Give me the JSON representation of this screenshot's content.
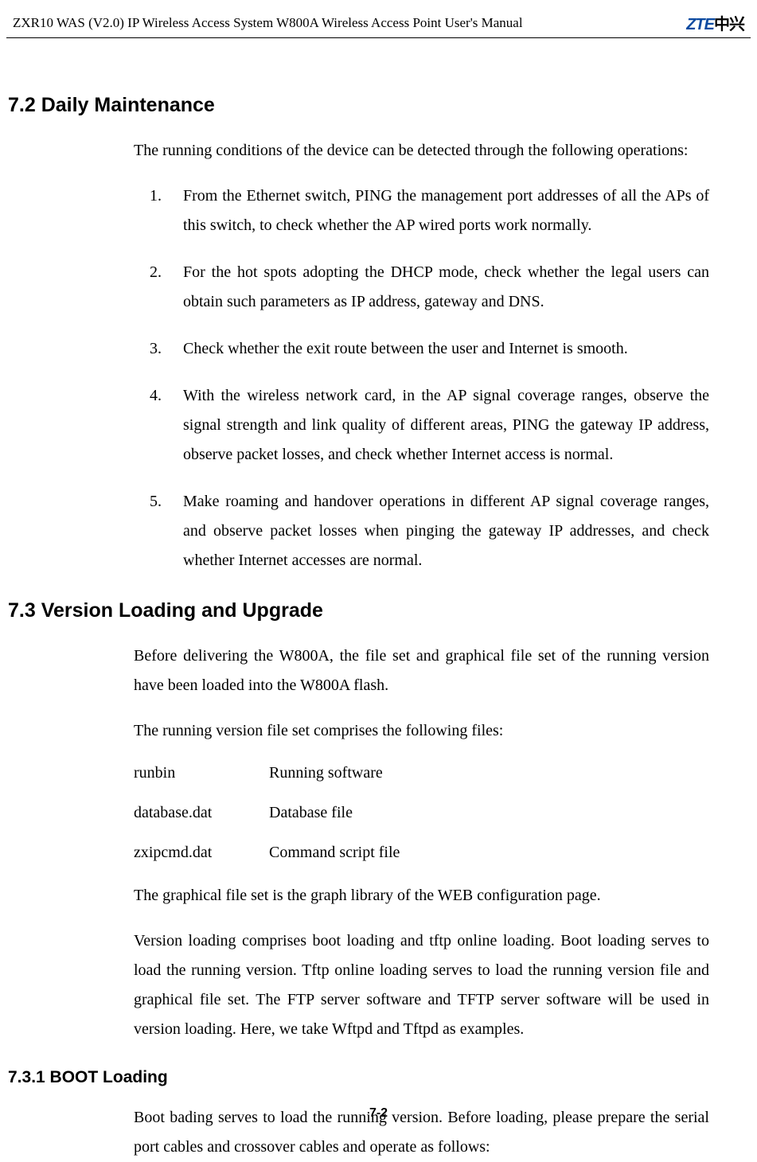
{
  "header": {
    "doc_title": "ZXR10 WAS (V2.0) IP Wireless Access System W800A Wireless Access Point User's Manual",
    "logo_text_a": "ZTE",
    "logo_text_b": "中兴"
  },
  "section_7_2": {
    "heading": "7.2 Daily Maintenance",
    "intro": "The running conditions of the device can be detected through the following operations:",
    "items": [
      "From the Ethernet switch, PING the management port addresses of all the APs of this switch, to check whether the AP wired ports work normally.",
      "For the hot spots adopting the DHCP mode, check whether the legal users can obtain such parameters as IP address, gateway and DNS.",
      "Check whether the exit route between the user and Internet is smooth.",
      "With the wireless network card, in the AP signal coverage ranges, observe the signal strength and link quality of different areas, PING the gateway IP address, observe packet losses, and check whether Internet access is normal.",
      "Make roaming and handover operations in different AP signal coverage ranges, and observe packet losses when pinging the gateway IP addresses, and check whether Internet accesses are normal."
    ]
  },
  "section_7_3": {
    "heading": "7.3 Version Loading and Upgrade",
    "para1": "Before delivering the W800A, the file set and graphical file set of the running version have been loaded into the W800A flash.",
    "para2": "The running version file set comprises the following files:",
    "files": [
      {
        "name": "runbin",
        "desc": "Running software"
      },
      {
        "name": "database.dat",
        "desc": "Database file"
      },
      {
        "name": "zxipcmd.dat",
        "desc": "Command script file"
      }
    ],
    "para3": "The graphical file set is the graph library of the WEB configuration page.",
    "para4": "Version loading comprises boot loading and tftp online loading. Boot loading serves to load the running version. Tftp online loading serves to load the running version file and graphical file set. The FTP server software and TFTP server software will be used in version loading. Here, we take Wftpd and Tftpd as examples."
  },
  "section_7_3_1": {
    "heading": "7.3.1 BOOT Loading",
    "para1": "Boot bading serves to load the running version. Before loading, please prepare the serial port cables and crossover cables and operate as follows:"
  },
  "footer": {
    "page_number": "7-2"
  }
}
